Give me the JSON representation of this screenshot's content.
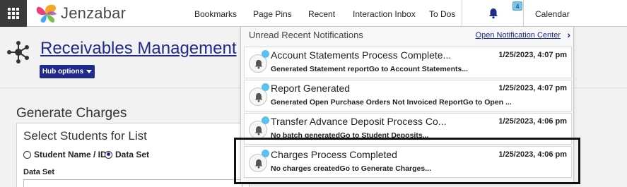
{
  "topbar": {
    "logo_text": "Jenzabar",
    "nav": [
      "Bookmarks",
      "Page Pins",
      "Recent",
      "Interaction Inbox",
      "To Dos",
      "Calendar"
    ],
    "notification_count": "4"
  },
  "header": {
    "title": "Receivables Management",
    "hub_options": "Hub options"
  },
  "form": {
    "section_title": "Generate Charges",
    "subsection_title": "Select Students for List",
    "radio_student": "Student Name / ID",
    "radio_dataset": "Data Set",
    "dataset_label": "Data Set",
    "selected_radio": "Data Set"
  },
  "notifications": {
    "heading": "Unread Recent Notifications",
    "open_center": "Open Notification Center",
    "items": [
      {
        "title": "Account Statements Process Complete...",
        "time": "1/25/2023, 4:07 pm",
        "message": "Generated Statement reportGo to Account Statements..."
      },
      {
        "title": "Report Generated",
        "time": "1/25/2023, 4:07 pm",
        "message": "Generated Open Purchase Orders Not Invoiced ReportGo to Open ..."
      },
      {
        "title": "Transfer Advance Deposit Process Co...",
        "time": "1/25/2023, 4:06 pm",
        "message": "No batch generatedGo to Student Deposits..."
      },
      {
        "title": "Charges Process Completed",
        "time": "1/25/2023, 4:06 pm",
        "message": "No charges createdGo to Generate Charges..."
      }
    ]
  },
  "colors": {
    "brand_blue": "#1f2a8a",
    "unread_dot": "#5cc0ef",
    "badge": "#78c6ec"
  }
}
